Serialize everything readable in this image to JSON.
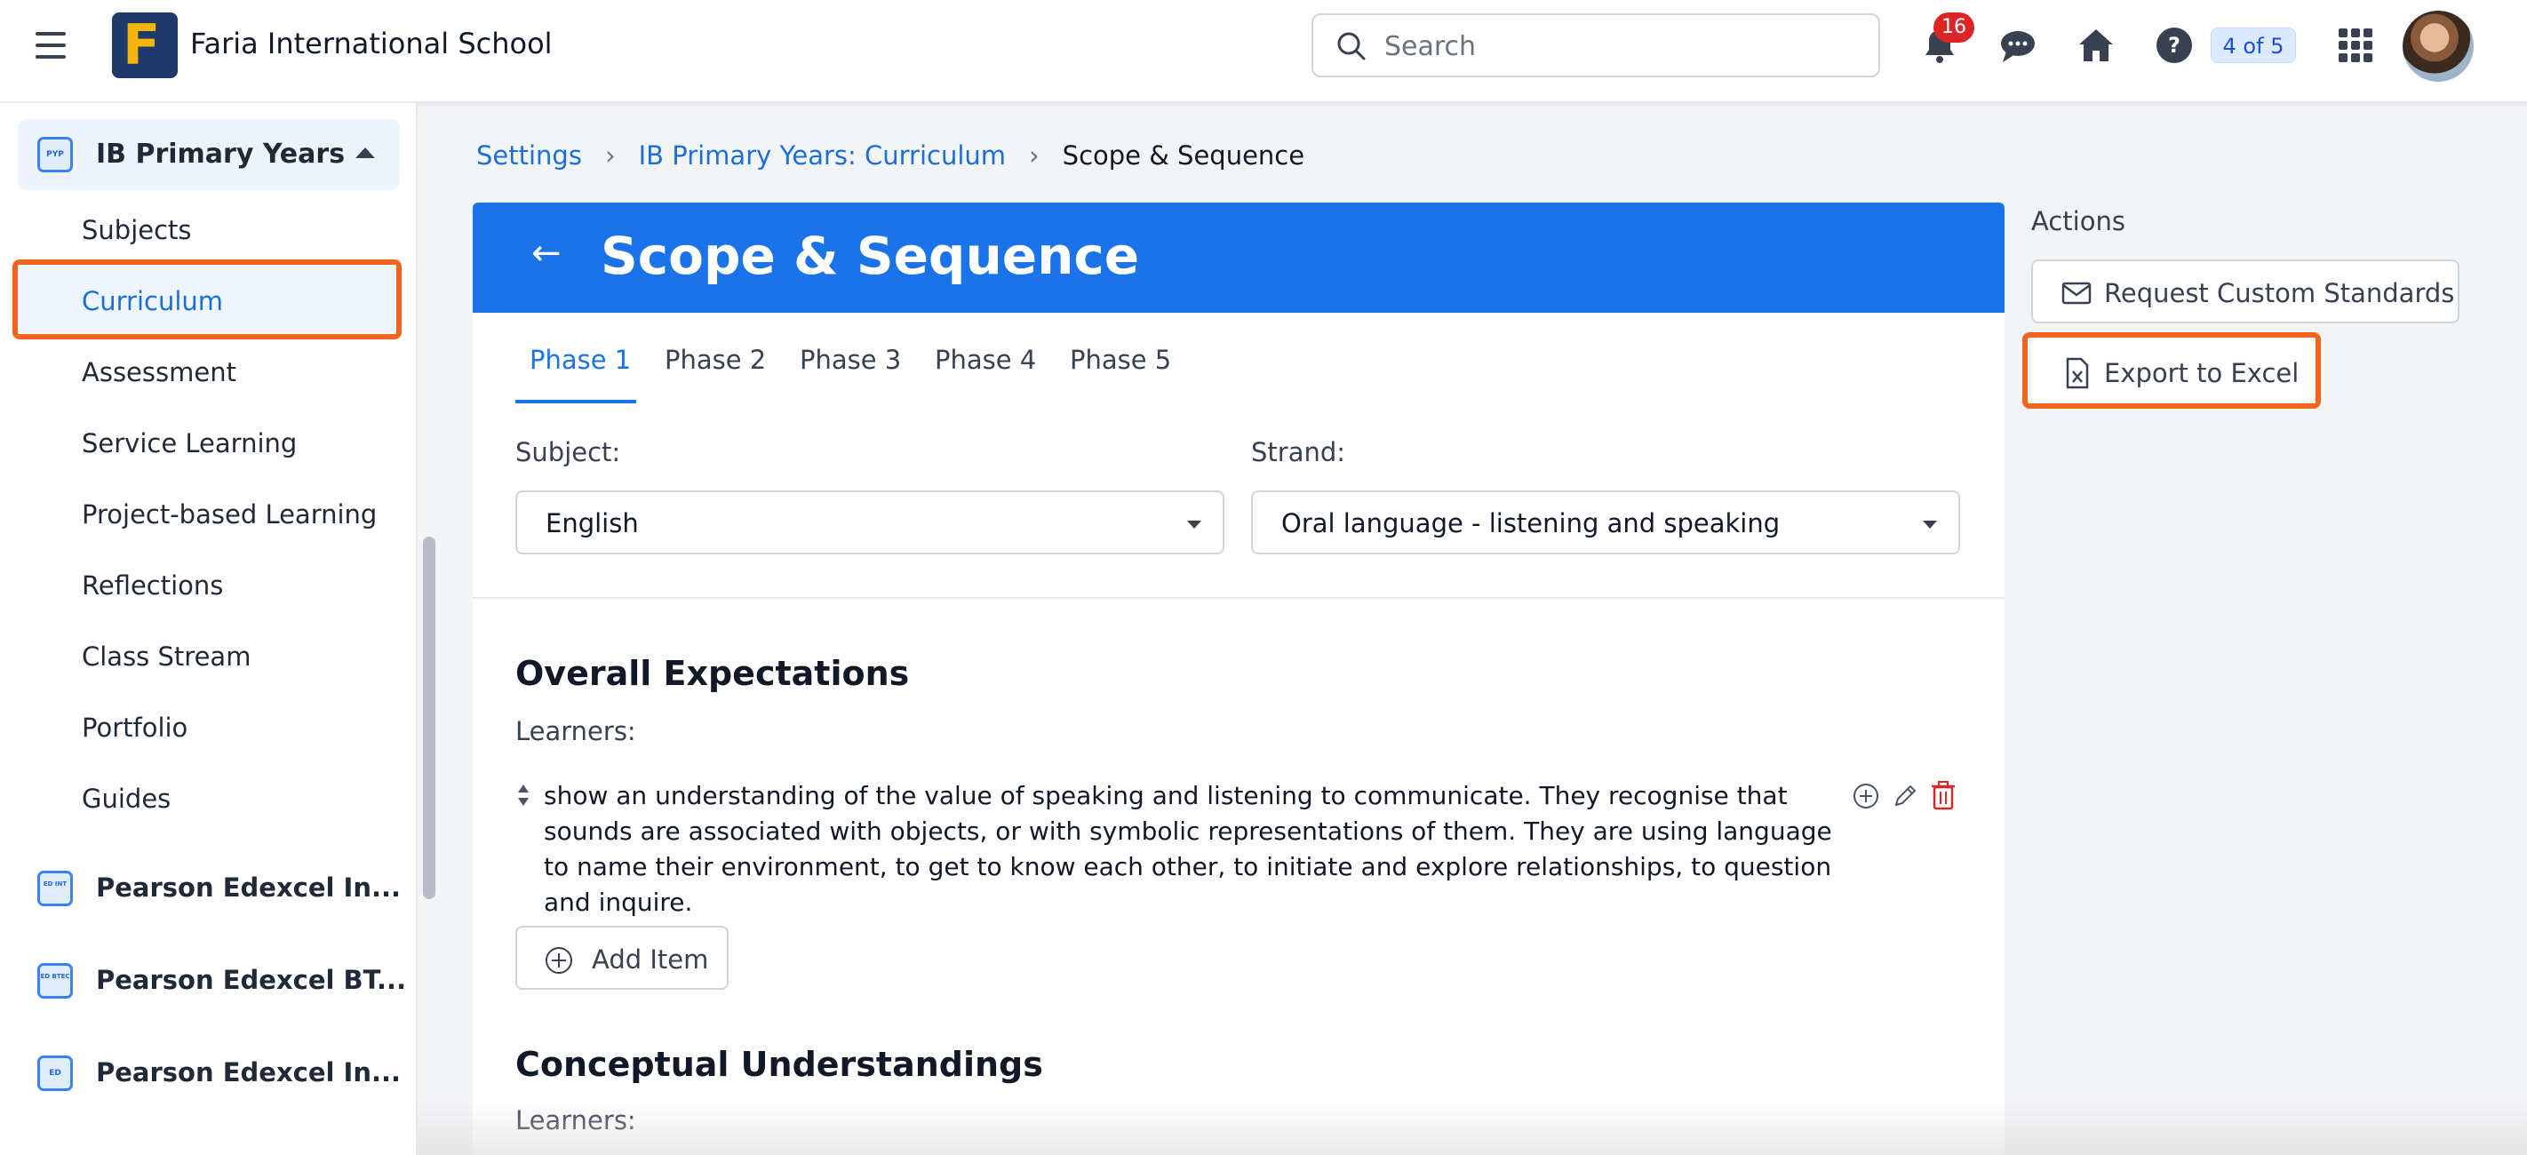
{
  "topbar": {
    "school_name": "Faria International School",
    "logo_letter": "F",
    "search_placeholder": "Search",
    "notification_count": "16",
    "pager": "4 of 5"
  },
  "sidebar": {
    "group_label": "IB Primary Years",
    "group_icon_text": "PYP",
    "items": [
      {
        "label": "Subjects"
      },
      {
        "label": "Curriculum"
      },
      {
        "label": "Assessment"
      },
      {
        "label": "Service Learning"
      },
      {
        "label": "Project-based Learning"
      },
      {
        "label": "Reflections"
      },
      {
        "label": "Class Stream"
      },
      {
        "label": "Portfolio"
      },
      {
        "label": "Guides"
      }
    ],
    "courses": [
      {
        "label": "Pearson Edexcel In...",
        "icon_text": "ED INT"
      },
      {
        "label": "Pearson Edexcel BT...",
        "icon_text": "ED BTEC"
      },
      {
        "label": "Pearson Edexcel In...",
        "icon_text": "ED"
      }
    ]
  },
  "breadcrumb": {
    "items": [
      "Settings",
      "IB Primary Years: Curriculum",
      "Scope & Sequence"
    ]
  },
  "page": {
    "title": "Scope & Sequence",
    "back_arrow": "←",
    "tabs": [
      "Phase 1",
      "Phase 2",
      "Phase 3",
      "Phase 4",
      "Phase 5"
    ],
    "subject_label": "Subject:",
    "subject_value": "English",
    "strand_label": "Strand:",
    "strand_value": "Oral language - listening and speaking",
    "sections": [
      {
        "title": "Overall Expectations",
        "learners": "Learners:",
        "item_text": "show an understanding of the value of speaking and listening to communicate. They recognise that sounds are associated with objects, or with symbolic representations of them. They are using language to name their environment, to get to know each other, to initiate and explore relationships, to question and inquire."
      },
      {
        "title": "Conceptual Understandings",
        "learners": "Learners:"
      }
    ],
    "add_item_label": "Add Item"
  },
  "actions": {
    "title": "Actions",
    "request_label": "Request Custom Standards",
    "export_label": "Export to Excel"
  },
  "colors": {
    "brand_blue": "#1a73e8",
    "highlight_orange": "#f0641e",
    "badge_red": "#dc2626",
    "delete_red": "#dc2626"
  }
}
